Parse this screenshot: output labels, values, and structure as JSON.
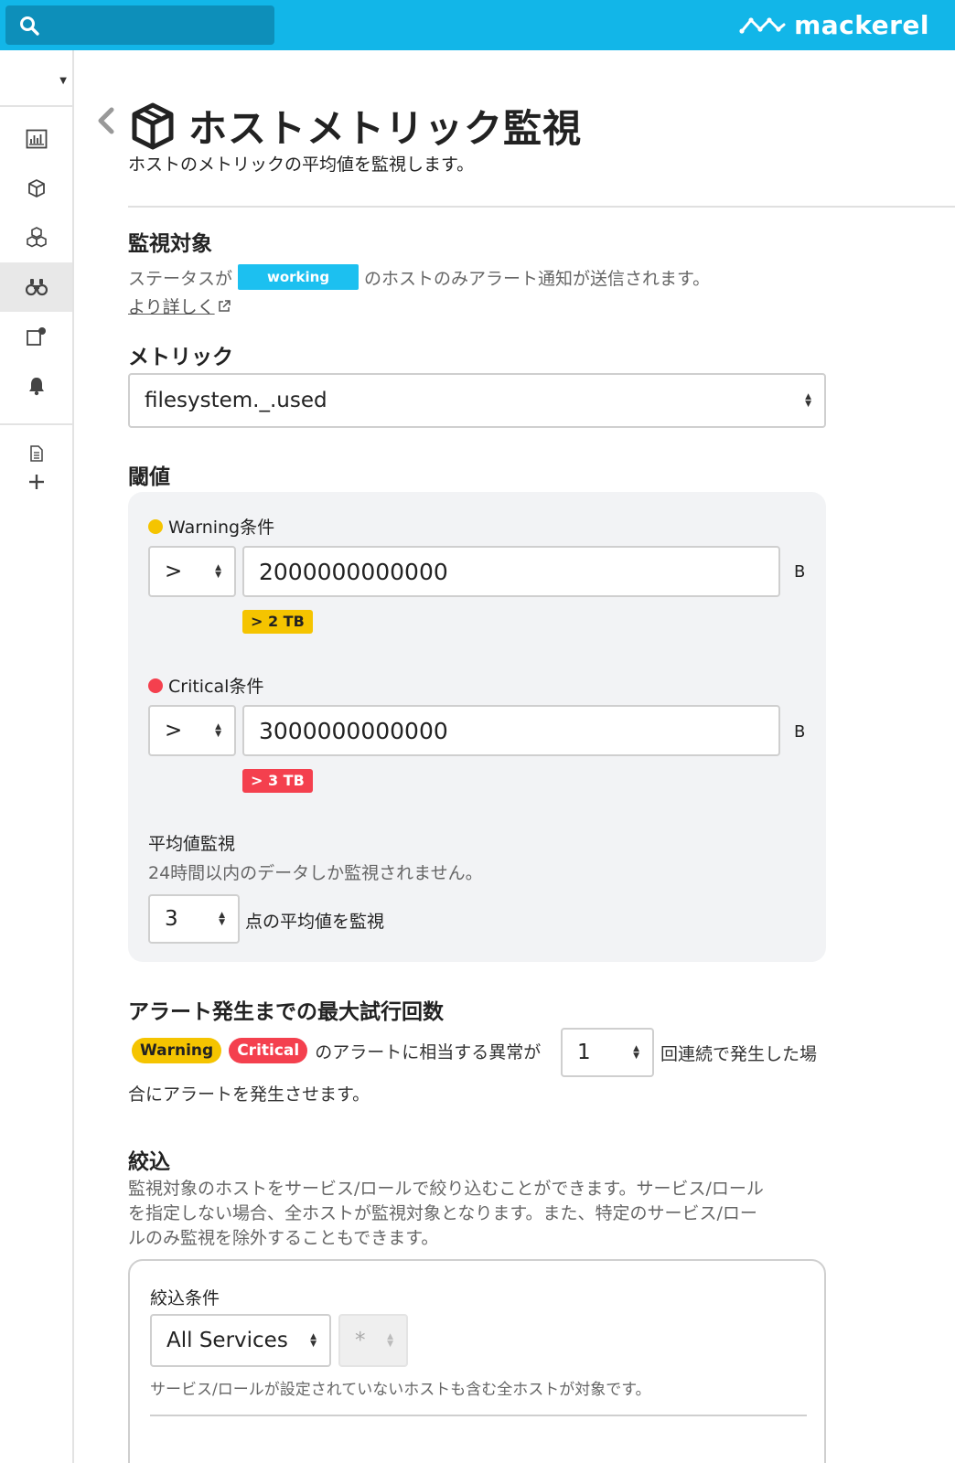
{
  "header": {
    "search_placeholder": "",
    "logo_text": "mackerel"
  },
  "page": {
    "title": "ホストメトリック監視",
    "description": "ホストのメトリックの平均値を監視します。"
  },
  "target": {
    "title": "監視対象",
    "text_before": "ステータスが",
    "status_badge": "working",
    "text_after": "のホストのみアラート通知が送信されます。",
    "detail_link": "より詳しく"
  },
  "metric": {
    "title": "メトリック",
    "selected": "filesystem._.used"
  },
  "threshold": {
    "title": "閾値",
    "warning": {
      "label": "Warning条件",
      "operator": ">",
      "value": "2000000000000",
      "unit": "B",
      "badge": "> 2 TB",
      "color": "#f5c400"
    },
    "critical": {
      "label": "Critical条件",
      "operator": ">",
      "value": "3000000000000",
      "unit": "B",
      "badge": "> 3 TB",
      "color": "#f4404e"
    },
    "average": {
      "title": "平均値監視",
      "note": "24時間以内のデータしか監視されません。",
      "points": "3",
      "suffix": "点の平均値を監視"
    }
  },
  "max_attempts": {
    "title": "アラート発生までの最大試行回数",
    "warning_pill": "Warning",
    "critical_pill": "Critical",
    "text_before": "のアラートに相当する異常が",
    "count": "1",
    "text_after_line1": "回連続で発生した場",
    "text_after_line2": "合にアラートを発生させます。"
  },
  "filter": {
    "title": "絞込",
    "description_line1": "監視対象のホストをサービス/ロールで絞り込むことができます。サービス/ロール",
    "description_line2": "を指定しない場合、全ホストが監視対象となります。また、特定のサービス/ロー",
    "description_line3": "ルのみ監視を除外することもできます。",
    "condition_label": "絞込条件",
    "service_selected": "All Services",
    "role_selected": "*",
    "note": "サービス/ロールが設定されていないホストも含む全ホストが対象です。"
  }
}
